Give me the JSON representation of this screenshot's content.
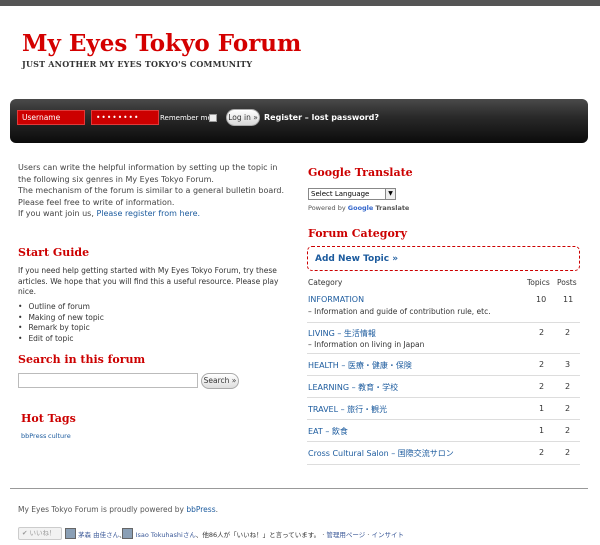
{
  "header": {
    "title": "My Eyes Tokyo Forum",
    "tagline": "JUST ANOTHER MY EYES TOKYO'S COMMUNITY"
  },
  "login": {
    "username_placeholder": "Username",
    "password_value": "••••••••",
    "remember_label": "Remember me",
    "login_button": "Log in »",
    "register_link": "Register – lost password?"
  },
  "intro": {
    "line1": "Users can write the helpful information by setting up the topic in the following six genres in My Eyes Tokyo Forum.",
    "line2": "The mechanism of the forum is similar to a general bulletin board. Please feel free to write of information.",
    "line3_prefix": "If you want join us, ",
    "line3_link": "Please register from here."
  },
  "start_guide": {
    "title": "Start Guide",
    "text": "If you need help getting started with My Eyes Tokyo Forum, try these articles. We hope that you will find this a useful resource. Please play nice.",
    "items": [
      "Outline of forum",
      "Making of new topic",
      "Remark by topic",
      "Edit of topic"
    ]
  },
  "search": {
    "title": "Search in this forum",
    "button": "Search »"
  },
  "hot_tags": {
    "title": "Hot Tags",
    "tags": [
      "bbPress",
      "culture"
    ]
  },
  "google_translate": {
    "title": "Google Translate",
    "select_label": "Select Language",
    "powered_prefix": "Powered by",
    "google": "Google",
    "translate": "Translate"
  },
  "forum_category": {
    "title": "Forum Category",
    "add_topic": "Add New Topic »",
    "col_category": "Category",
    "col_topics": "Topics",
    "col_posts": "Posts",
    "rows": [
      {
        "name": "INFORMATION",
        "desc": "– Information and guide of contribution rule, etc.",
        "topics": "10",
        "posts": "11"
      },
      {
        "name": "LIVING – 生活情報",
        "desc": "– Information on living in Japan",
        "topics": "2",
        "posts": "2"
      },
      {
        "name": "HEALTH – 医療・健康・保険",
        "desc": "",
        "topics": "2",
        "posts": "3"
      },
      {
        "name": "LEARNING – 教育・学校",
        "desc": "",
        "topics": "2",
        "posts": "2"
      },
      {
        "name": "TRAVEL – 旅行・観光",
        "desc": "",
        "topics": "1",
        "posts": "2"
      },
      {
        "name": "EAT – 飲食",
        "desc": "",
        "topics": "1",
        "posts": "2"
      },
      {
        "name": "Cross Cultural Salon – 国際交流サロン",
        "desc": "",
        "topics": "2",
        "posts": "2"
      }
    ]
  },
  "footer": {
    "text_prefix": "My Eyes Tokyo Forum is proudly powered by ",
    "link": "bbPress",
    "text_suffix": "."
  },
  "social": {
    "like_button": "✔ いいね！",
    "name1": "茅森 由佳さん",
    "name2": "Isao Tokuhashiさん",
    "rest": "、他86人が「いいね！」と言っています。",
    "manage": "管理用ページ",
    "insight": "インサイト"
  }
}
